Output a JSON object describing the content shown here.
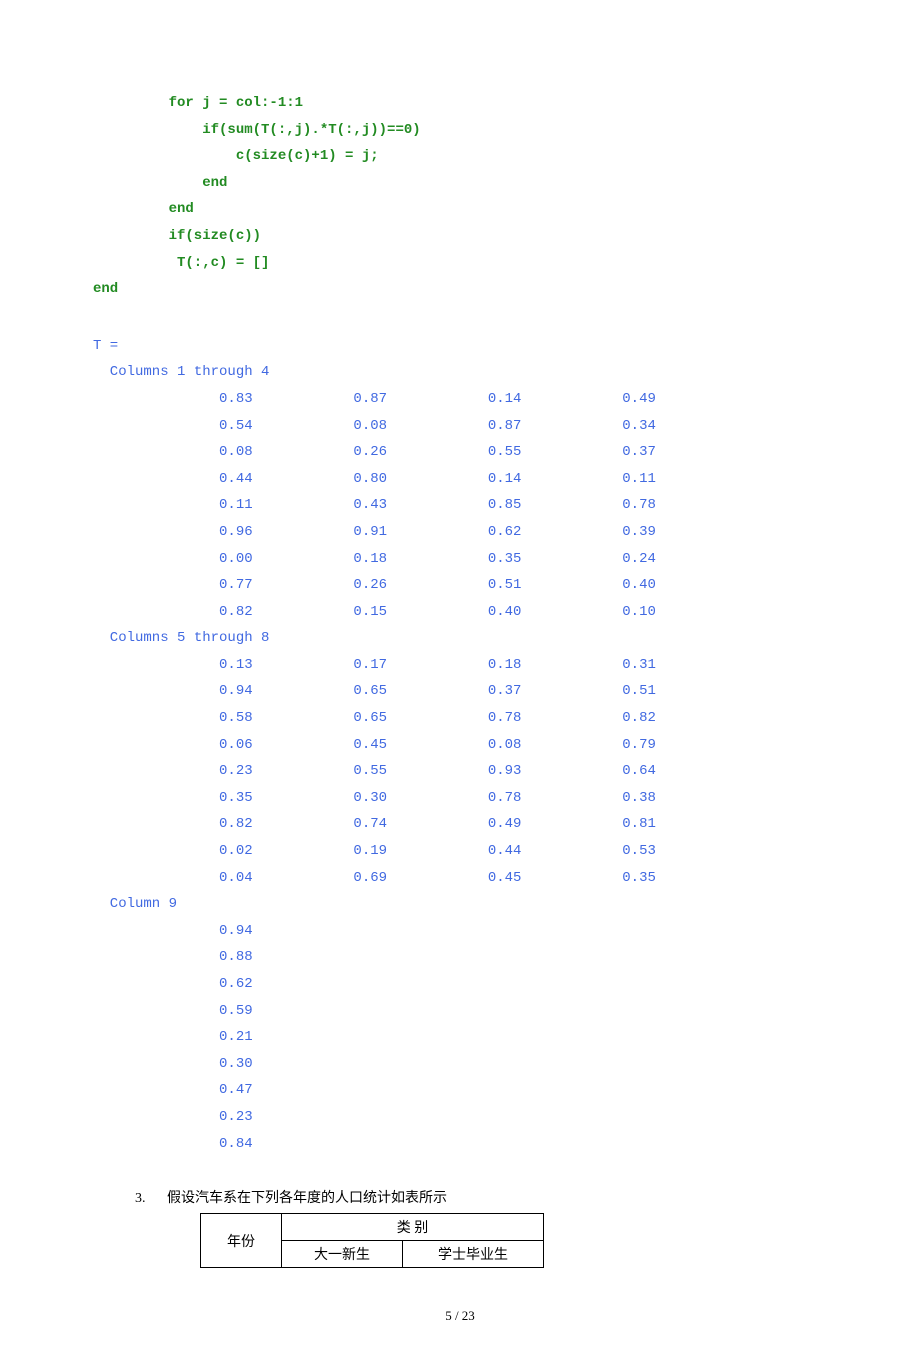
{
  "code": {
    "l1": "    for j = col:-1:1",
    "l2": "        if(sum(T(:,j).*T(:,j))==0)",
    "l3": "            c(size(c)+1) = j;",
    "l4": "        end",
    "l5": "    end",
    "l6": "    if(size(c))",
    "l7": "     T(:,c) = []",
    "l8": "end"
  },
  "output": {
    "var": "T =",
    "header1": "  Columns 1 through 4",
    "header2": "  Columns 5 through 8",
    "header3": "  Column 9",
    "block1": [
      [
        "0.83",
        "0.87",
        "0.14",
        "0.49"
      ],
      [
        "0.54",
        "0.08",
        "0.87",
        "0.34"
      ],
      [
        "0.08",
        "0.26",
        "0.55",
        "0.37"
      ],
      [
        "0.44",
        "0.80",
        "0.14",
        "0.11"
      ],
      [
        "0.11",
        "0.43",
        "0.85",
        "0.78"
      ],
      [
        "0.96",
        "0.91",
        "0.62",
        "0.39"
      ],
      [
        "0.00",
        "0.18",
        "0.35",
        "0.24"
      ],
      [
        "0.77",
        "0.26",
        "0.51",
        "0.40"
      ],
      [
        "0.82",
        "0.15",
        "0.40",
        "0.10"
      ]
    ],
    "block2": [
      [
        "0.13",
        "0.17",
        "0.18",
        "0.31"
      ],
      [
        "0.94",
        "0.65",
        "0.37",
        "0.51"
      ],
      [
        "0.58",
        "0.65",
        "0.78",
        "0.82"
      ],
      [
        "0.06",
        "0.45",
        "0.08",
        "0.79"
      ],
      [
        "0.23",
        "0.55",
        "0.93",
        "0.64"
      ],
      [
        "0.35",
        "0.30",
        "0.78",
        "0.38"
      ],
      [
        "0.82",
        "0.74",
        "0.49",
        "0.81"
      ],
      [
        "0.02",
        "0.19",
        "0.44",
        "0.53"
      ],
      [
        "0.04",
        "0.69",
        "0.45",
        "0.35"
      ]
    ],
    "block3": [
      [
        "0.94"
      ],
      [
        "0.88"
      ],
      [
        "0.62"
      ],
      [
        "0.59"
      ],
      [
        "0.21"
      ],
      [
        "0.30"
      ],
      [
        "0.47"
      ],
      [
        "0.23"
      ],
      [
        "0.84"
      ]
    ]
  },
  "question": {
    "num": "3.",
    "text": "假设汽车系在下列各年度的人口统计如表所示"
  },
  "table": {
    "r1c1": "年份",
    "r1c2": "类 别",
    "r2c1": "大一新生",
    "r2c2": "学士毕业生"
  },
  "pagenum": "5 / 23"
}
